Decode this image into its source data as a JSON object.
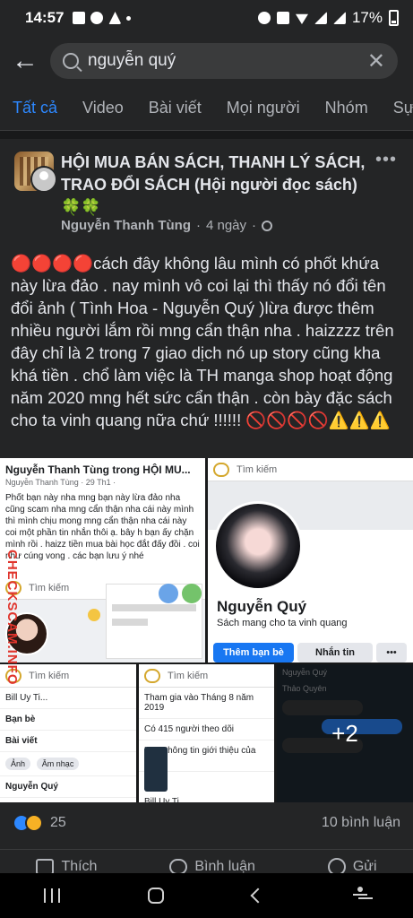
{
  "status_bar": {
    "time": "14:57",
    "battery": "17%"
  },
  "search": {
    "query": "nguyễn quý",
    "back_icon": "arrow-left-icon",
    "clear_icon": "close-icon"
  },
  "tabs": [
    {
      "label": "Tất cả",
      "active": true
    },
    {
      "label": "Video"
    },
    {
      "label": "Bài viết"
    },
    {
      "label": "Mọi người"
    },
    {
      "label": "Nhóm"
    },
    {
      "label": "Sự"
    }
  ],
  "post": {
    "group_name": "HỘI MUA BÁN SÁCH, THANH LÝ SÁCH, TRAO ĐỔI SÁCH (Hội người đọc sách)🍀🍀",
    "author": "Nguyễn Thanh Tùng",
    "time": "4 ngày",
    "text": "🔴🔴🔴🔴cách đây không lâu mình có phốt khứa này lừa đảo . nay mình vô coi lại thì thấy nó đổi tên đổi ảnh ( Tình Hoa - Nguyễn Quý )lừa được thêm nhiều người lắm rồi mng cẩn thận nha . haizzzz trên đây chỉ là 2 trong 7 giao dịch nó up story cũng kha khá tiền . chổ làm việc là TH manga shop hoạt động năm 2020 mng hết sức cẩn thận . còn bày đặc sách cho ta vinh quang nữa chứ !!!!!! 🚫🚫🚫🚫⚠️⚠️⚠️",
    "more_label": "•••",
    "watermark": "CHECKSCAM.INFO"
  },
  "images": {
    "tile1": {
      "header": "Nguyễn Thanh Tùng trong HỘI MU...",
      "sub": "Nguyễn Thanh Tùng · 29 Th1 ·",
      "body": "Phốt bạn này nha mng bạn này lừa đảo nha cũng scam nha mng cẩn thận nha  cái này mình thì mình chịu mong mng cẩn thận nha cái này coi một phần tin nhắn thôi ạ. bây h bạn ấy chặn mình rồi . haizz tiền mua bài học đắt đấy đồi . coi như cúng vong . các bạn lưu ý nhé",
      "search_placeholder": "Tìm kiếm"
    },
    "tile2": {
      "search_placeholder": "Tìm kiếm",
      "profile_name": "Nguyễn Quý",
      "bio": "Sách mang cho ta vinh quang",
      "add_friend": "Thêm bạn bè",
      "message": "Nhắn tin",
      "more": "•••"
    },
    "tile3": {
      "search_placeholder": "Tìm kiếm",
      "rows": [
        "Bill Uy Ti...",
        "Bạn bè",
        "Bài viết"
      ],
      "chips": [
        "Ảnh",
        "Âm nhạc"
      ],
      "footer": "Nguyễn Quý"
    },
    "tile4": {
      "search_placeholder": "Tìm kiếm",
      "rows": [
        "Tham gia vào Tháng 8 năm 2019",
        "Có 415 người theo dõi",
        "Xem thông tin giới thiệu của Quý"
      ],
      "caption": "Bill Uy Ti...",
      "footer": "Bạn bè"
    },
    "tile5": {
      "header": "Nguyễn Quý",
      "name2": "Thảo Quyên",
      "overlay": "+2"
    }
  },
  "reactions": {
    "count": "25",
    "comments": "10 bình luận"
  },
  "actions": {
    "like": "Thích",
    "comment": "Bình luận",
    "share": "Gửi"
  }
}
